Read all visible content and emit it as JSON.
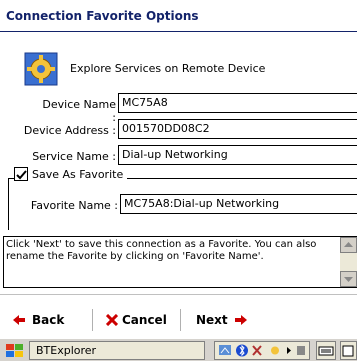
{
  "header": {
    "title": "Connection Favorite Options"
  },
  "section": {
    "title": "Explore Services on Remote Device",
    "icon": "gear-explore-icon"
  },
  "form": {
    "device_name_label": "Device Name :",
    "device_name_value": "MC75A8",
    "device_address_label": "Device Address :",
    "device_address_value": "001570DD08C2",
    "service_name_label": "Service Name :",
    "service_name_value": "Dial-up Networking",
    "save_favorite_label": "Save As Favorite",
    "save_favorite_checked": true,
    "favorite_name_label": "Favorite Name :",
    "favorite_name_value": "MC75A8:Dial-up Networking"
  },
  "help": {
    "text": "Click 'Next' to save this connection as a Favorite.  You can also rename the Favorite by clicking on 'Favorite Name'."
  },
  "toolbar": {
    "back_label": "Back",
    "cancel_label": "Cancel",
    "next_label": "Next"
  },
  "taskbar": {
    "task_label": "BTExplorer"
  },
  "colors": {
    "accent": "#13236a",
    "arrow": "#cc0000",
    "cancel_x": "#cc0000"
  }
}
